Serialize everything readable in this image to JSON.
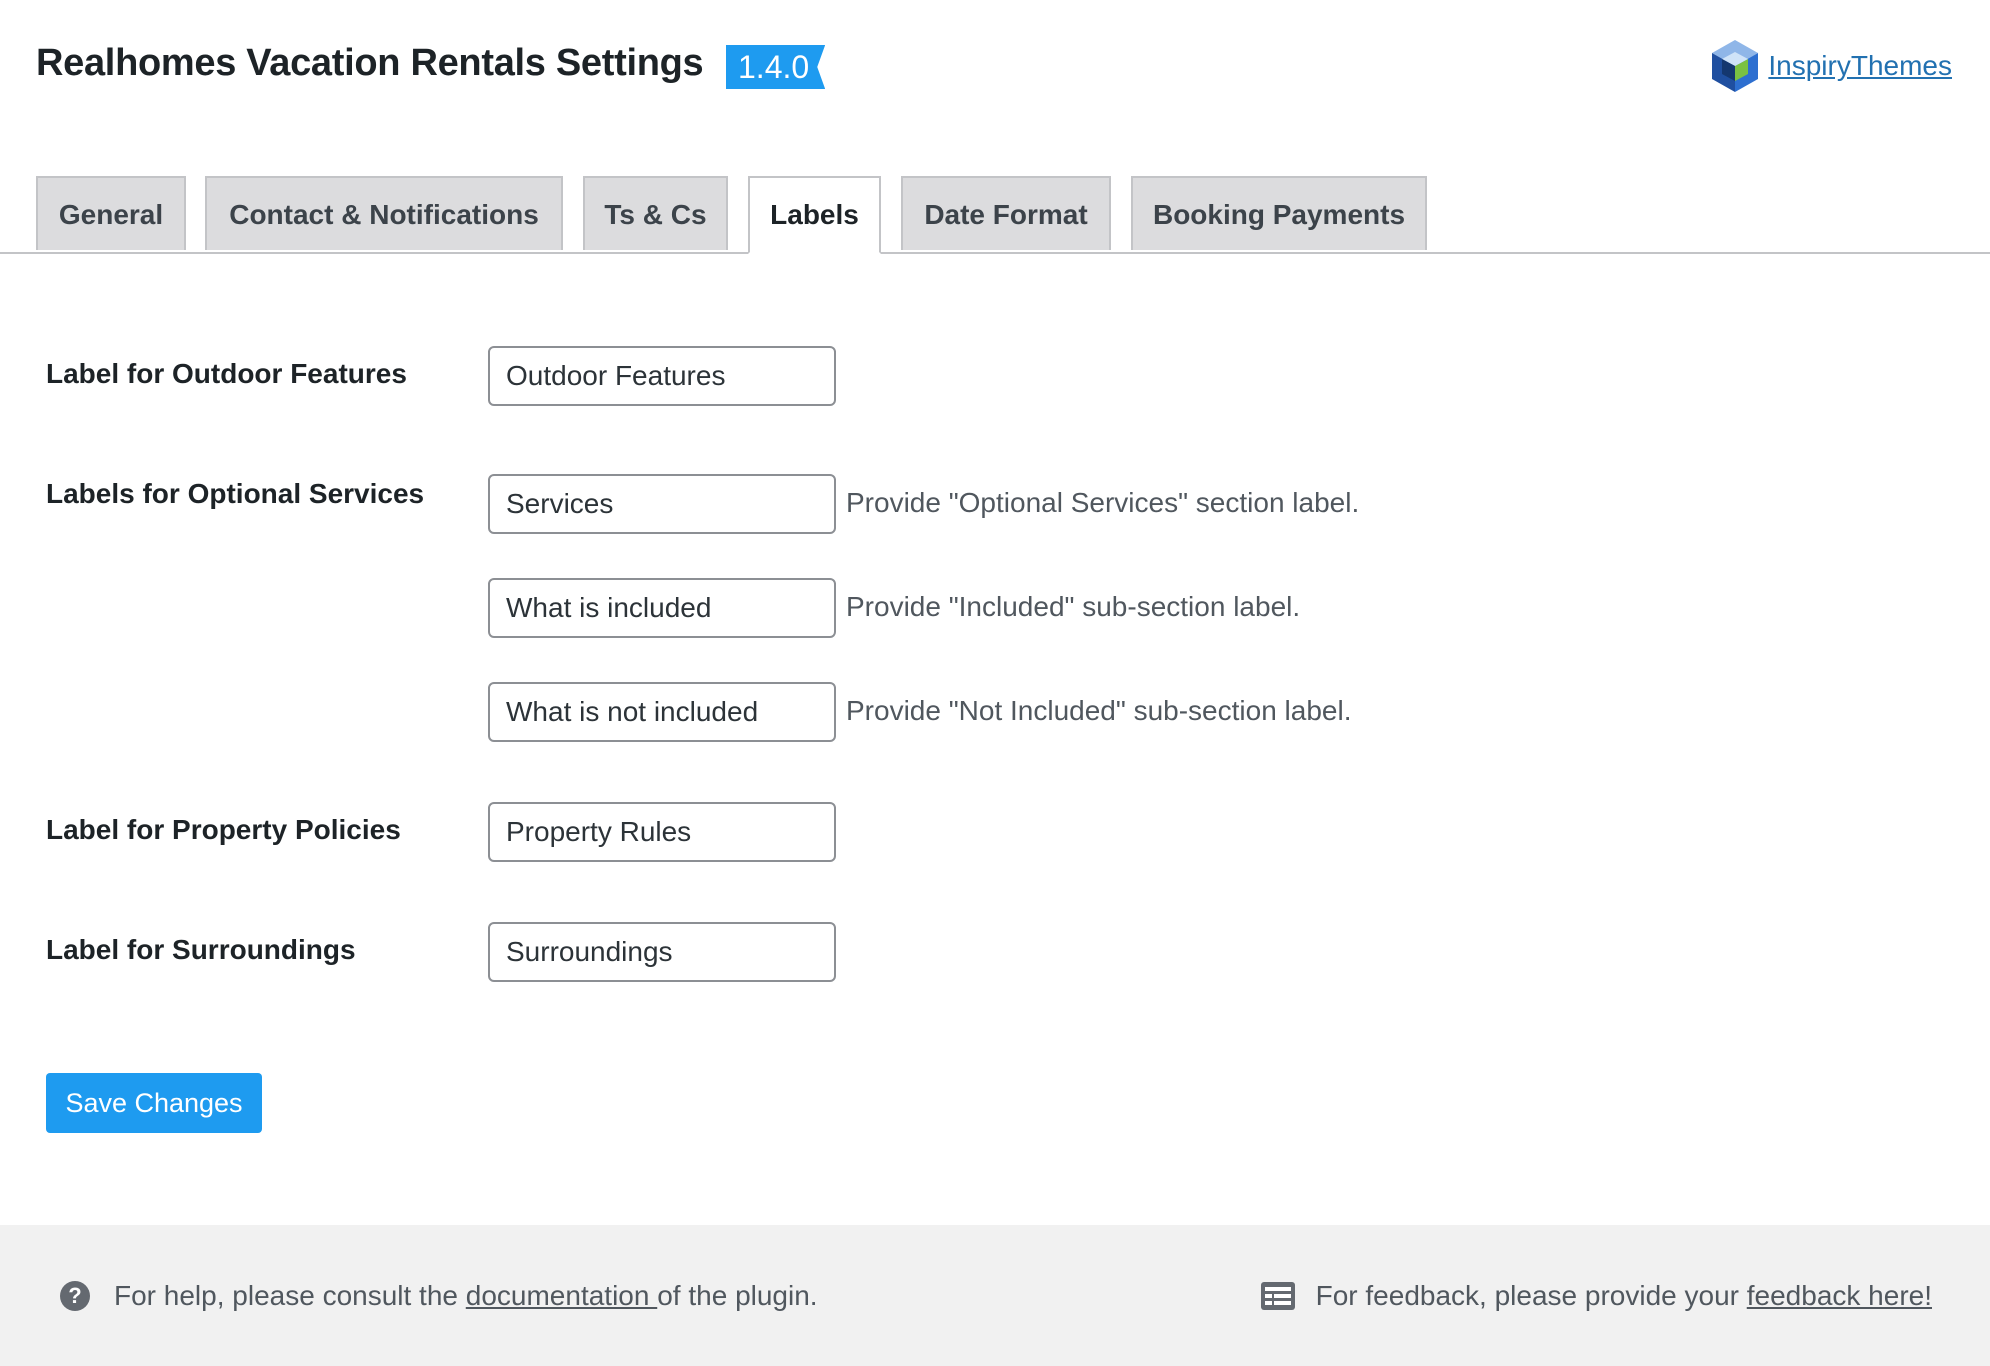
{
  "header": {
    "title": "Realhomes Vacation Rentals Settings",
    "version": "1.4.0",
    "brand_link": "InspiryThemes",
    "brand_icon": "inspirythemes-logo-icon"
  },
  "tabs": [
    {
      "label": "General",
      "active": false
    },
    {
      "label": "Contact & Notifications",
      "active": false
    },
    {
      "label": "Ts & Cs",
      "active": false
    },
    {
      "label": "Labels",
      "active": true
    },
    {
      "label": "Date Format",
      "active": false
    },
    {
      "label": "Booking Payments",
      "active": false
    }
  ],
  "fields": {
    "outdoor": {
      "label": "Label for Outdoor Features",
      "value": "Outdoor Features"
    },
    "optional_services": {
      "label": "Labels for Optional Services",
      "section_value": "Services",
      "section_hint": "Provide \"Optional Services\" section label.",
      "included_value": "What is included",
      "included_hint": "Provide \"Included\" sub-section label.",
      "not_included_value": "What is not included",
      "not_included_hint": "Provide \"Not Included\" sub-section label."
    },
    "policies": {
      "label": "Label for Property Policies",
      "value": "Property Rules"
    },
    "surroundings": {
      "label": "Label for Surroundings",
      "value": "Surroundings"
    }
  },
  "save_button": "Save Changes",
  "footer": {
    "help_prefix": "For help, please consult the",
    "help_link": "documentation ",
    "help_suffix": "of the plugin.",
    "feedback_prefix": "For feedback, please provide your",
    "feedback_link": "feedback here!"
  },
  "colors": {
    "accent": "#1e9bf0",
    "link": "#2271b1",
    "tab_inactive_bg": "#dcdcde"
  }
}
